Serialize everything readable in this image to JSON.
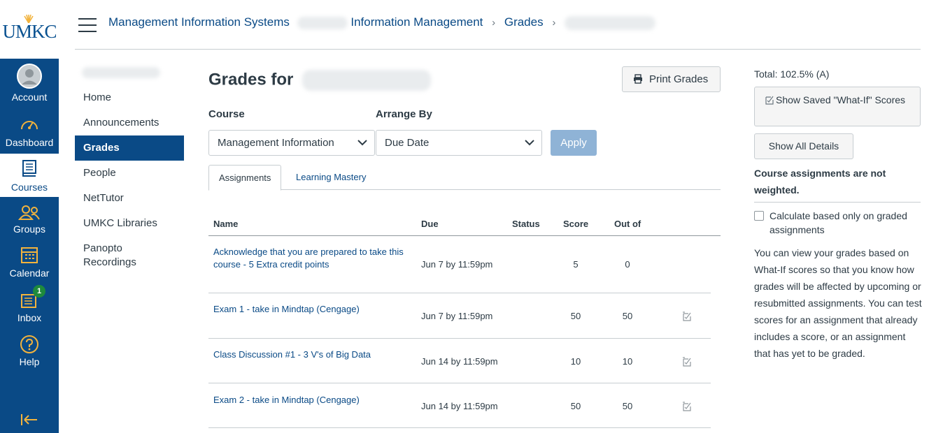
{
  "logo": {
    "text": "UMKC"
  },
  "global_nav": [
    {
      "label": "Account",
      "icon": "account-icon"
    },
    {
      "label": "Dashboard",
      "icon": "dashboard-icon"
    },
    {
      "label": "Courses",
      "icon": "courses-icon"
    },
    {
      "label": "Groups",
      "icon": "groups-icon"
    },
    {
      "label": "Calendar",
      "icon": "calendar-icon"
    },
    {
      "label": "Inbox",
      "icon": "inbox-icon",
      "badge": "1"
    },
    {
      "label": "Help",
      "icon": "help-icon"
    }
  ],
  "breadcrumbs": {
    "course": "Management Information Systems",
    "section": "Information Management",
    "page": "Grades"
  },
  "course_nav": [
    {
      "label": "Home"
    },
    {
      "label": "Announcements"
    },
    {
      "label": "Grades",
      "active": true
    },
    {
      "label": "People"
    },
    {
      "label": "NetTutor"
    },
    {
      "label": "UMKC Libraries"
    },
    {
      "label": "Panopto Recordings"
    }
  ],
  "main": {
    "title": "Grades for",
    "print_button": "Print Grades",
    "course_label": "Course",
    "course_value": "Management Information",
    "arrange_label": "Arrange By",
    "arrange_value": "Due Date",
    "apply_button": "Apply",
    "tabs": [
      {
        "label": "Assignments"
      },
      {
        "label": "Learning Mastery"
      }
    ],
    "columns": {
      "name": "Name",
      "due": "Due",
      "status": "Status",
      "score": "Score",
      "out_of": "Out of"
    },
    "rows": [
      {
        "name": "Acknowledge that you are prepared to take this course - 5 Extra credit points",
        "due": "Jun 7 by 11:59pm",
        "score": "5",
        "out_of": "0",
        "whatif": false
      },
      {
        "name": "Exam 1 - take in Mindtap (Cengage)",
        "due": "Jun 7 by 11:59pm",
        "score": "50",
        "out_of": "50",
        "whatif": true
      },
      {
        "name": "Class Discussion #1 - 3 V's of Big Data",
        "due": "Jun 14 by 11:59pm",
        "score": "10",
        "out_of": "10",
        "whatif": true
      },
      {
        "name": "Exam 2 - take in Mindtap (Cengage)",
        "due": "Jun 14 by 11:59pm",
        "score": "50",
        "out_of": "50",
        "whatif": true
      }
    ]
  },
  "sidebar": {
    "total": "Total: 102.5% (A)",
    "saved_whatif_button": "Show Saved \"What-If\" Scores",
    "show_details_button": "Show All Details",
    "not_weighted": "Course assignments are not weighted.",
    "checkbox_label": "Calculate based only on graded assignments",
    "whatif_text": "You can view your grades based on What-If scores so that you know how grades will be affected by upcoming or resubmitted assignments. You can test scores for an assignment that already includes a score, or an assignment that has yet to be graded."
  },
  "colors": {
    "brand": "#0a4a86",
    "link": "#0a4a86",
    "apply_disabled": "#8fb3d6",
    "badge": "#1e8a3c"
  }
}
